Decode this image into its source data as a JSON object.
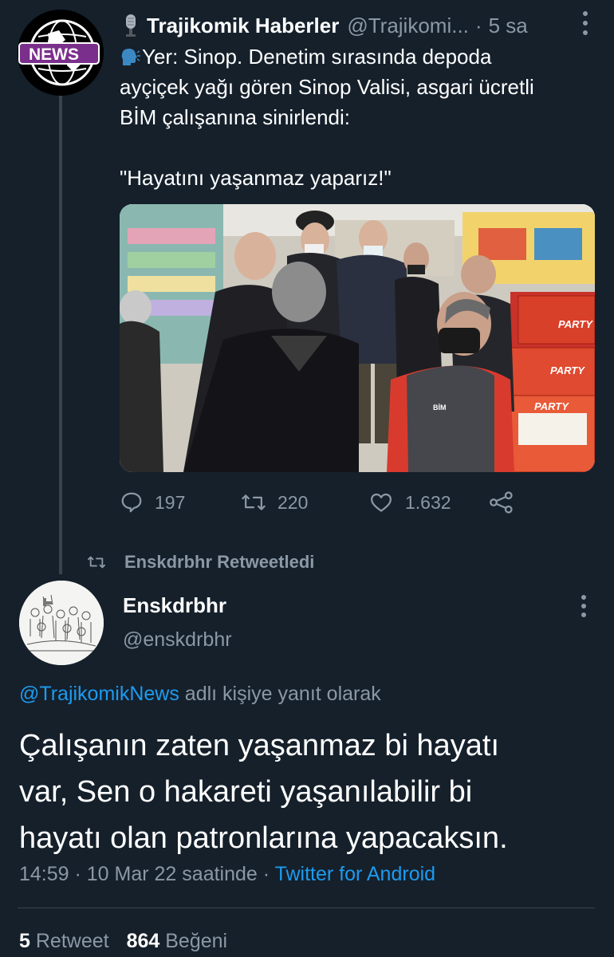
{
  "original_tweet": {
    "author_name": "Trajikomik Haberler",
    "author_handle": "@Trajikomi...",
    "time_sep": "·",
    "time": "5 sa",
    "avatar_badge": "NEWS",
    "text_lines": [
      "Yer: Sinop. Denetim sırasında depoda",
      "ayçiçek yağı gören Sinop Valisi, asgari ücretli",
      "BİM çalışanına sinirlendi:",
      "",
      "\"Hayatını yaşanmaz yaparız!\""
    ],
    "replies": "197",
    "retweets": "220",
    "likes": "1.632",
    "photo_labels": {
      "box1": "PARTY",
      "box2": "PARTY",
      "box3": "PARTY",
      "vest": "BİM"
    }
  },
  "retweet_context": {
    "label": "Enskdrbhr Retweetledi"
  },
  "main_tweet": {
    "author_name": "Enskdrbhr",
    "author_handle": "@enskdrbhr",
    "reply_mention": "@TrajikomikNews",
    "reply_suffix": " adlı kişiye yanıt olarak",
    "text_lines": [
      "Çalışanın zaten yaşanmaz bi hayatı",
      "var, Sen o hakareti yaşanılabilir bi",
      "hayatı olan patronlarına yapacaksın."
    ],
    "timestamp": "14:59 · 10 Mar 22 saatinde",
    "meta_sep": " · ",
    "source": "Twitter for Android",
    "retweet_count": "5",
    "retweet_label": "Retweet",
    "like_count": "864",
    "like_label": "Beğeni"
  },
  "colors": {
    "background": "#15202b",
    "text_primary": "#ffffff",
    "text_secondary": "#8b98a5",
    "accent": "#1d9bf0",
    "divider": "#38444d"
  }
}
